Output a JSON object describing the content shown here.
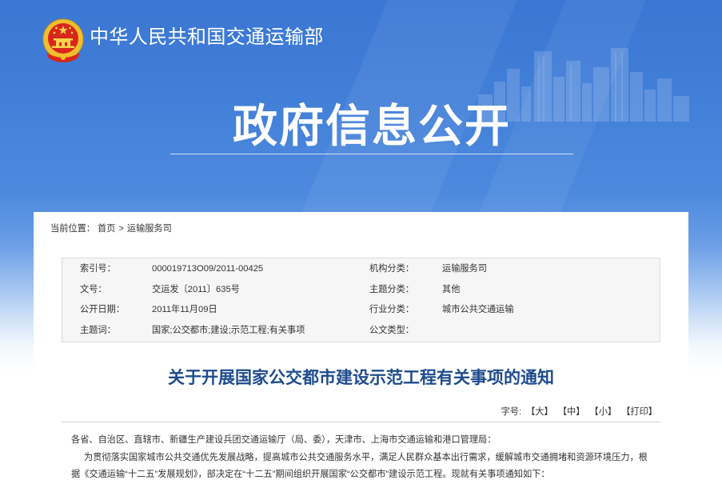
{
  "header": {
    "ministry_name": "中华人民共和国交通运输部",
    "section_title": "政府信息公开",
    "emblem_icon": "national-emblem-icon",
    "skyline_icon": "city-skyline-illustration"
  },
  "breadcrumb": {
    "prefix": "当前位置：",
    "items": [
      "首页",
      "运输服务司"
    ],
    "separator": ">"
  },
  "metadata": {
    "rows": [
      {
        "label1": "索引号：",
        "value1": "000019713O09/2011-00425",
        "label2": "机构分类：",
        "value2": "运输服务司"
      },
      {
        "label1": "文号：",
        "value1": "交运发〔2011〕635号",
        "label2": "主题分类：",
        "value2": "其他"
      },
      {
        "label1": "公开日期：",
        "value1": "2011年11月09日",
        "label2": "行业分类：",
        "value2": "城市公共交通运输"
      },
      {
        "label1": "主题词：",
        "value1": "国家;公交都市;建设;示范工程;有关事项",
        "label2": "公文类型："
      }
    ]
  },
  "article": {
    "title": "关于开展国家公交都市建设示范工程有关事项的通知",
    "paragraphs": [
      "各省、自治区、直辖市、新疆生产建设兵团交通运输厅（局、委），天津市、上海市交通运输和港口管理局：",
      "为贯彻落实国家城市公共交通优先发展战略，提高城市公共交通服务水平，满足人民群众基本出行需求，缓解城市交通拥堵和资源环境压力，根据《交通运输“十二五”发展规划》，部决定在“十二五”期间组织开展国家“公交都市”建设示范工程。现就有关事项通知如下："
    ]
  },
  "font_tools": {
    "label": "字号:",
    "large": "【大】",
    "medium": "【中】",
    "small": "【小】",
    "print": "【打印】"
  },
  "colors": {
    "header_blue": "#3a76d3",
    "title_blue": "#1e4b8c",
    "text": "#333333",
    "meta_background": "#f6f6f6",
    "panel_background": "#ffffff"
  }
}
